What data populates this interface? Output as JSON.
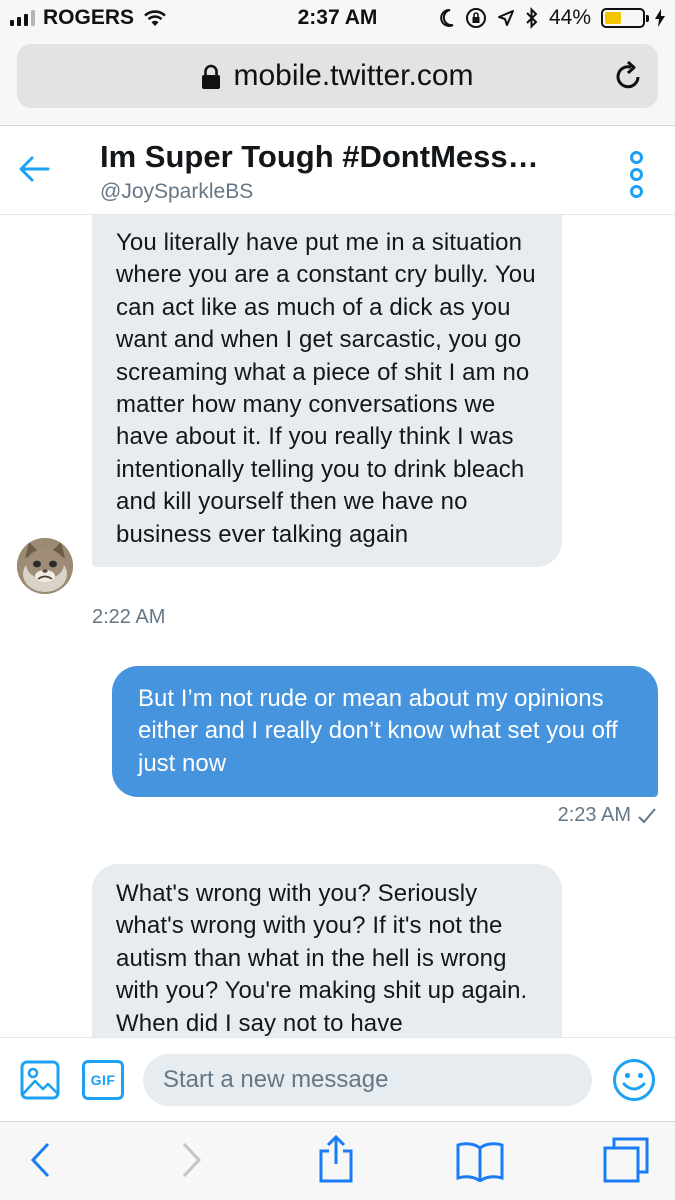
{
  "status_bar": {
    "carrier": "ROGERS",
    "time": "2:37 AM",
    "battery_percent": "44%",
    "battery_level": 0.44,
    "battery_color": "#f2c500"
  },
  "browser": {
    "url": "mobile.twitter.com",
    "lock_icon": "lock-icon",
    "reload_icon": "reload-icon"
  },
  "conversation": {
    "title": "Im Super Tough #DontMess…",
    "handle": "@JoySparkleBS",
    "accent_color": "#1da1f2"
  },
  "messages": [
    {
      "direction": "received",
      "text": "You literally have put me  in a situation where you are a constant cry bully. You can act like as much of a dick as you want and when I get sarcastic, you go screaming what a piece of shit I am no matter how many conversations we have about it. If you really think I was intentionally telling you to drink bleach and kill yourself then we have no business ever talking again",
      "time": "2:22 AM"
    },
    {
      "direction": "sent",
      "text": "But I’m not rude or mean about my opinions either and I really don’t know what set you off just now",
      "time": "2:23 AM",
      "bubble_color": "#4794de"
    },
    {
      "direction": "received",
      "text": "What's wrong with you? Seriously what's wrong with you? If it's not the autism than what in the hell is wrong with you? You're making shit up again. When did I say not to have"
    }
  ],
  "composer": {
    "placeholder": "Start a new message",
    "gif_label": "GIF"
  }
}
